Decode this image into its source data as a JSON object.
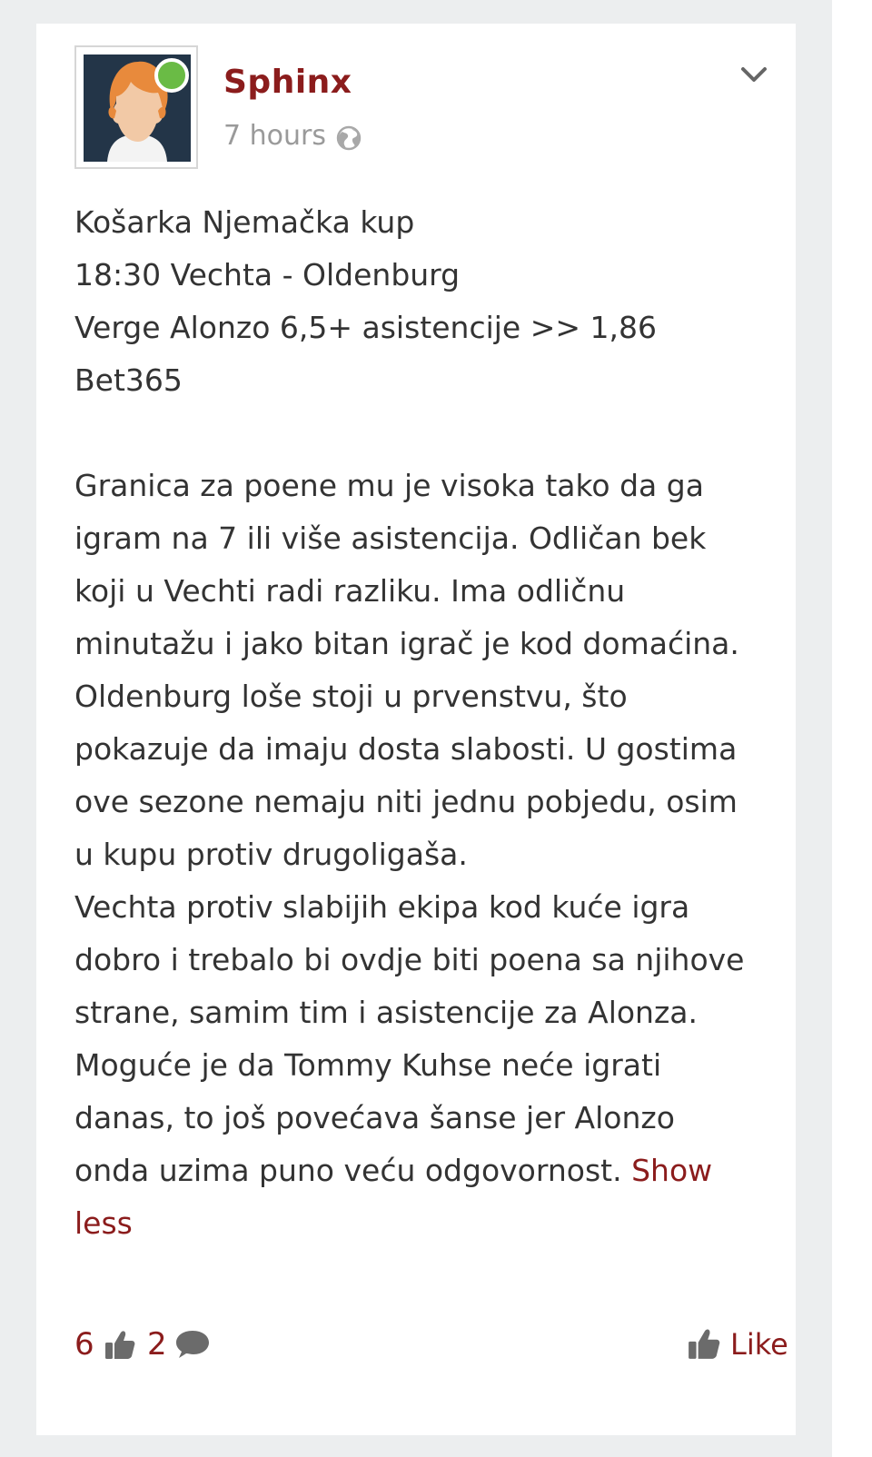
{
  "post": {
    "author": "Sphinx",
    "time": "7 hours",
    "status_color": "#6abb45",
    "accent_color": "#8b1c1c",
    "lines": [
      "Košarka Njemačka kup",
      "18:30 Vechta - Oldenburg",
      "Verge Alonzo 6,5+ asistencije >> 1,86",
      "Bet365",
      "",
      "Granica za poene mu je visoka tako da ga",
      "igram na 7 ili više asistencija. Odličan bek",
      "koji u Vechti radi razliku. Ima odličnu",
      "minutažu i jako bitan igrač je kod domaćina.",
      "Oldenburg loše stoji u prvenstvu, što",
      "pokazuje da imaju dosta slabosti. U gostima",
      "ove sezone nemaju niti jednu pobjedu, osim",
      "u kupu protiv drugoligaša.",
      "Vechta protiv slabijih ekipa kod kuće igra",
      "dobro i trebalo bi ovdje biti poena sa njihove",
      "strane, samim tim i asistencije za Alonza.",
      "Moguće je da Tommy Kuhse neće igrati",
      "danas, to još povećava šanse jer Alonzo",
      "onda uzima puno veću odgovornost."
    ],
    "show_less_first": "Show",
    "show_less_second": "less",
    "likes": "6",
    "comments": "2",
    "like_label": "Like"
  },
  "icons": {
    "avatar": "avatar-icon",
    "globe": "globe-icon",
    "menu": "chevron-down-icon",
    "likes": "thumbs-up-icon",
    "comments": "comment-bubble-icon",
    "like_button": "thumbs-up-icon"
  }
}
